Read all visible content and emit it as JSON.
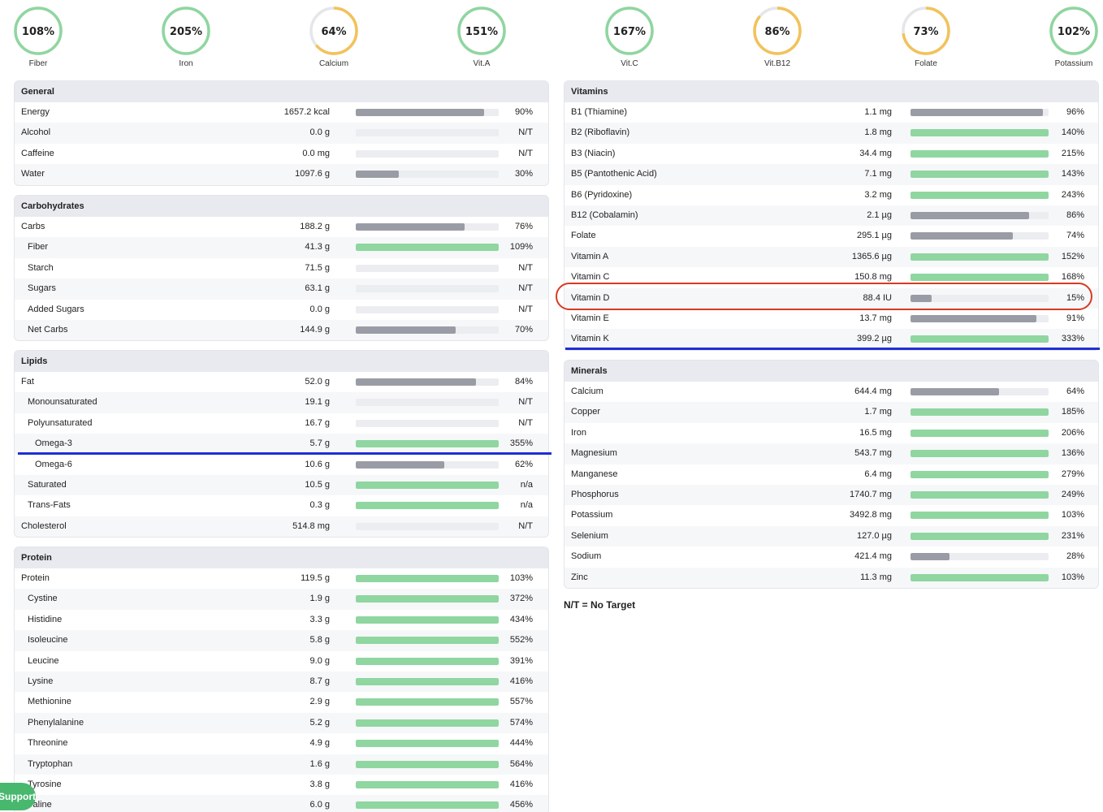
{
  "colors": {
    "green": "#8fd6a0",
    "grey": "#9a9ca5",
    "orange": "#f2c25a",
    "ring_green": "#8fd6a0",
    "highlight_red": "#d83a22",
    "marker_blue": "#1f2fd4",
    "support_green": "#47b86d"
  },
  "summary": [
    {
      "label": "Fiber",
      "pct_text": "108%",
      "pct": 108,
      "color": "green"
    },
    {
      "label": "Iron",
      "pct_text": "205%",
      "pct": 205,
      "color": "green"
    },
    {
      "label": "Calcium",
      "pct_text": "64%",
      "pct": 64,
      "color": "orange"
    },
    {
      "label": "Vit.A",
      "pct_text": "151%",
      "pct": 151,
      "color": "green"
    },
    {
      "label": "Vit.C",
      "pct_text": "167%",
      "pct": 167,
      "color": "green"
    },
    {
      "label": "Vit.B12",
      "pct_text": "86%",
      "pct": 86,
      "color": "orange"
    },
    {
      "label": "Folate",
      "pct_text": "73%",
      "pct": 73,
      "color": "orange"
    },
    {
      "label": "Potassium",
      "pct_text": "102%",
      "pct": 102,
      "color": "green"
    }
  ],
  "sections": {
    "general": {
      "title": "General",
      "rows": [
        {
          "name": "Energy",
          "amount": "1657.2 kcal",
          "pct_text": "90%",
          "fill": 0.9,
          "color": "grey",
          "indent": 0
        },
        {
          "name": "Alcohol",
          "amount": "0.0 g",
          "pct_text": "N/T",
          "fill": 0,
          "color": "grey",
          "indent": 0
        },
        {
          "name": "Caffeine",
          "amount": "0.0 mg",
          "pct_text": "N/T",
          "fill": 0,
          "color": "grey",
          "indent": 0
        },
        {
          "name": "Water",
          "amount": "1097.6 g",
          "pct_text": "30%",
          "fill": 0.3,
          "color": "grey",
          "indent": 0
        }
      ]
    },
    "carbohydrates": {
      "title": "Carbohydrates",
      "rows": [
        {
          "name": "Carbs",
          "amount": "188.2 g",
          "pct_text": "76%",
          "fill": 0.76,
          "color": "grey",
          "indent": 0
        },
        {
          "name": "Fiber",
          "amount": "41.3 g",
          "pct_text": "109%",
          "fill": 1,
          "color": "green",
          "indent": 1
        },
        {
          "name": "Starch",
          "amount": "71.5 g",
          "pct_text": "N/T",
          "fill": 0,
          "color": "grey",
          "indent": 1
        },
        {
          "name": "Sugars",
          "amount": "63.1 g",
          "pct_text": "N/T",
          "fill": 0,
          "color": "grey",
          "indent": 1
        },
        {
          "name": "Added Sugars",
          "amount": "0.0 g",
          "pct_text": "N/T",
          "fill": 0,
          "color": "grey",
          "indent": 1
        },
        {
          "name": "Net Carbs",
          "amount": "144.9 g",
          "pct_text": "70%",
          "fill": 0.7,
          "color": "grey",
          "indent": 1
        }
      ]
    },
    "lipids": {
      "title": "Lipids",
      "rows": [
        {
          "name": "Fat",
          "amount": "52.0 g",
          "pct_text": "84%",
          "fill": 0.84,
          "color": "grey",
          "indent": 0
        },
        {
          "name": "Monounsaturated",
          "amount": "19.1 g",
          "pct_text": "N/T",
          "fill": 0,
          "color": "grey",
          "indent": 1
        },
        {
          "name": "Polyunsaturated",
          "amount": "16.7 g",
          "pct_text": "N/T",
          "fill": 0,
          "color": "grey",
          "indent": 1
        },
        {
          "name": "Omega-3",
          "amount": "5.7 g",
          "pct_text": "355%",
          "fill": 1,
          "color": "green",
          "indent": 2
        },
        {
          "name": "Omega-6",
          "amount": "10.6 g",
          "pct_text": "62%",
          "fill": 0.62,
          "color": "grey",
          "indent": 2
        },
        {
          "name": "Saturated",
          "amount": "10.5 g",
          "pct_text": "n/a",
          "fill": 1,
          "color": "green",
          "indent": 1
        },
        {
          "name": "Trans-Fats",
          "amount": "0.3 g",
          "pct_text": "n/a",
          "fill": 1,
          "color": "green",
          "indent": 1
        },
        {
          "name": "Cholesterol",
          "amount": "514.8 mg",
          "pct_text": "N/T",
          "fill": 0,
          "color": "grey",
          "indent": 0
        }
      ]
    },
    "protein": {
      "title": "Protein",
      "rows": [
        {
          "name": "Protein",
          "amount": "119.5 g",
          "pct_text": "103%",
          "fill": 1,
          "color": "green",
          "indent": 0
        },
        {
          "name": "Cystine",
          "amount": "1.9 g",
          "pct_text": "372%",
          "fill": 1,
          "color": "green",
          "indent": 1
        },
        {
          "name": "Histidine",
          "amount": "3.3 g",
          "pct_text": "434%",
          "fill": 1,
          "color": "green",
          "indent": 1
        },
        {
          "name": "Isoleucine",
          "amount": "5.8 g",
          "pct_text": "552%",
          "fill": 1,
          "color": "green",
          "indent": 1
        },
        {
          "name": "Leucine",
          "amount": "9.0 g",
          "pct_text": "391%",
          "fill": 1,
          "color": "green",
          "indent": 1
        },
        {
          "name": "Lysine",
          "amount": "8.7 g",
          "pct_text": "416%",
          "fill": 1,
          "color": "green",
          "indent": 1
        },
        {
          "name": "Methionine",
          "amount": "2.9 g",
          "pct_text": "557%",
          "fill": 1,
          "color": "green",
          "indent": 1
        },
        {
          "name": "Phenylalanine",
          "amount": "5.2 g",
          "pct_text": "574%",
          "fill": 1,
          "color": "green",
          "indent": 1
        },
        {
          "name": "Threonine",
          "amount": "4.9 g",
          "pct_text": "444%",
          "fill": 1,
          "color": "green",
          "indent": 1
        },
        {
          "name": "Tryptophan",
          "amount": "1.6 g",
          "pct_text": "564%",
          "fill": 1,
          "color": "green",
          "indent": 1
        },
        {
          "name": "Tyrosine",
          "amount": "3.8 g",
          "pct_text": "416%",
          "fill": 1,
          "color": "green",
          "indent": 1
        },
        {
          "name": "Valine",
          "amount": "6.0 g",
          "pct_text": "456%",
          "fill": 1,
          "color": "green",
          "indent": 1
        }
      ]
    },
    "vitamins": {
      "title": "Vitamins",
      "rows": [
        {
          "name": "B1 (Thiamine)",
          "amount": "1.1 mg",
          "pct_text": "96%",
          "fill": 0.96,
          "color": "grey",
          "indent": 0
        },
        {
          "name": "B2 (Riboflavin)",
          "amount": "1.8 mg",
          "pct_text": "140%",
          "fill": 1,
          "color": "green",
          "indent": 0
        },
        {
          "name": "B3 (Niacin)",
          "amount": "34.4 mg",
          "pct_text": "215%",
          "fill": 1,
          "color": "green",
          "indent": 0
        },
        {
          "name": "B5 (Pantothenic Acid)",
          "amount": "7.1 mg",
          "pct_text": "143%",
          "fill": 1,
          "color": "green",
          "indent": 0
        },
        {
          "name": "B6 (Pyridoxine)",
          "amount": "3.2 mg",
          "pct_text": "243%",
          "fill": 1,
          "color": "green",
          "indent": 0
        },
        {
          "name": "B12 (Cobalamin)",
          "amount": "2.1 µg",
          "pct_text": "86%",
          "fill": 0.86,
          "color": "grey",
          "indent": 0
        },
        {
          "name": "Folate",
          "amount": "295.1 µg",
          "pct_text": "74%",
          "fill": 0.74,
          "color": "grey",
          "indent": 0
        },
        {
          "name": "Vitamin A",
          "amount": "1365.6 µg",
          "pct_text": "152%",
          "fill": 1,
          "color": "green",
          "indent": 0
        },
        {
          "name": "Vitamin C",
          "amount": "150.8 mg",
          "pct_text": "168%",
          "fill": 1,
          "color": "green",
          "indent": 0
        },
        {
          "name": "Vitamin D",
          "amount": "88.4 IU",
          "pct_text": "15%",
          "fill": 0.15,
          "color": "grey",
          "indent": 0
        },
        {
          "name": "Vitamin E",
          "amount": "13.7 mg",
          "pct_text": "91%",
          "fill": 0.91,
          "color": "grey",
          "indent": 0
        },
        {
          "name": "Vitamin K",
          "amount": "399.2 µg",
          "pct_text": "333%",
          "fill": 1,
          "color": "green",
          "indent": 0
        }
      ]
    },
    "minerals": {
      "title": "Minerals",
      "rows": [
        {
          "name": "Calcium",
          "amount": "644.4 mg",
          "pct_text": "64%",
          "fill": 0.64,
          "color": "grey",
          "indent": 0
        },
        {
          "name": "Copper",
          "amount": "1.7 mg",
          "pct_text": "185%",
          "fill": 1,
          "color": "green",
          "indent": 0
        },
        {
          "name": "Iron",
          "amount": "16.5 mg",
          "pct_text": "206%",
          "fill": 1,
          "color": "green",
          "indent": 0
        },
        {
          "name": "Magnesium",
          "amount": "543.7 mg",
          "pct_text": "136%",
          "fill": 1,
          "color": "green",
          "indent": 0
        },
        {
          "name": "Manganese",
          "amount": "6.4 mg",
          "pct_text": "279%",
          "fill": 1,
          "color": "green",
          "indent": 0
        },
        {
          "name": "Phosphorus",
          "amount": "1740.7 mg",
          "pct_text": "249%",
          "fill": 1,
          "color": "green",
          "indent": 0
        },
        {
          "name": "Potassium",
          "amount": "3492.8 mg",
          "pct_text": "103%",
          "fill": 1,
          "color": "green",
          "indent": 0
        },
        {
          "name": "Selenium",
          "amount": "127.0 µg",
          "pct_text": "231%",
          "fill": 1,
          "color": "green",
          "indent": 0
        },
        {
          "name": "Sodium",
          "amount": "421.4 mg",
          "pct_text": "28%",
          "fill": 0.28,
          "color": "grey",
          "indent": 0
        },
        {
          "name": "Zinc",
          "amount": "11.3 mg",
          "pct_text": "103%",
          "fill": 1,
          "color": "green",
          "indent": 0
        }
      ]
    }
  },
  "legend_note": "N/T = No Target",
  "support_button": "Support"
}
